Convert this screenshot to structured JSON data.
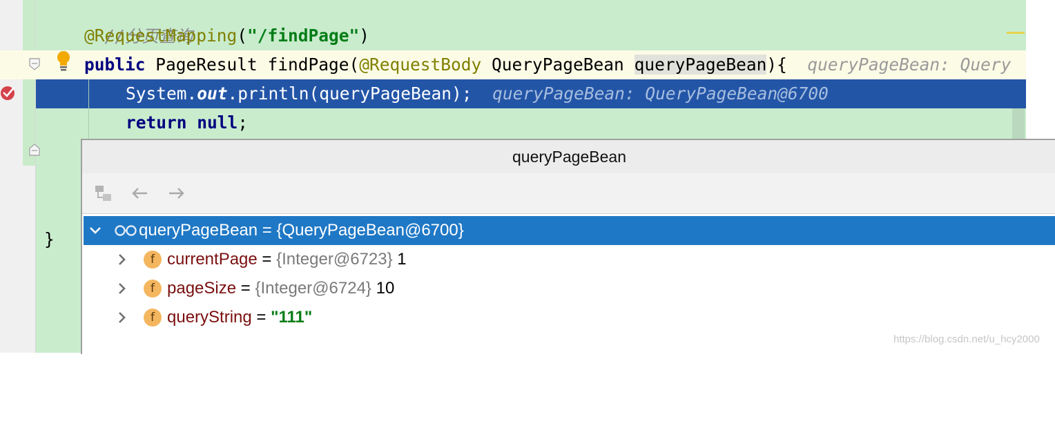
{
  "editor": {
    "comment_line": "//分页查询",
    "annotation_line": {
      "annotation": "@RequestMapping",
      "open": "(",
      "path": "\"/findPage\"",
      "close": ")"
    },
    "method_line": {
      "keyword": "public",
      "signature": " PageResult findPage(",
      "param_annotation": "@RequestBody",
      "param_type": " QueryPageBean ",
      "param_name": "queryPageBean",
      "tail": "){",
      "inline_hint": "queryPageBean: Query"
    },
    "print_line": {
      "prefix": "System.",
      "field": "out",
      "call": ".println(queryPageBean);",
      "inline_hint": "queryPageBean: QueryPageBean@6700"
    },
    "return_line": {
      "keyword_return": "return",
      "keyword_null": "null",
      "semicolon": ";"
    },
    "closing_brace": "}"
  },
  "popup": {
    "title": "queryPageBean",
    "root": {
      "text": "queryPageBean = {QueryPageBean@6700}"
    },
    "fields": [
      {
        "name": "currentPage",
        "equals": " = ",
        "type": "{Integer@6723}",
        "value": " 1"
      },
      {
        "name": "pageSize",
        "equals": " = ",
        "type": "{Integer@6724}",
        "value": " 10"
      },
      {
        "name": "queryString",
        "equals": " = ",
        "type": "",
        "value": "\"111\""
      }
    ],
    "field_icon_letter": "f"
  },
  "watermark": "https://blog.csdn.net/u_hcy2000",
  "colors": {
    "editor_bg": "#c9eccd",
    "exec_line": "#2355a7",
    "selected_row": "#1f78c5",
    "field_icon": "#f4b65e",
    "breakpoint": "#d5414b"
  }
}
